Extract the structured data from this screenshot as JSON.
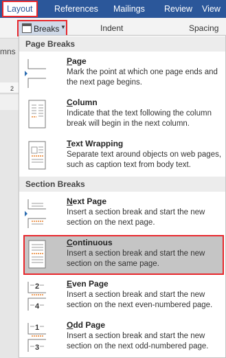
{
  "tabs": [
    {
      "label": "Layout",
      "active": true
    },
    {
      "label": "References",
      "active": false
    },
    {
      "label": "Mailings",
      "active": false
    },
    {
      "label": "Review",
      "active": false
    },
    {
      "label": "View",
      "active": false
    }
  ],
  "ribbon": {
    "breaks_label": "Breaks",
    "indent_label": "Indent",
    "spacing_label": "Spacing",
    "columns_fragment": "mns",
    "ruler_number": "2"
  },
  "menu": {
    "page_breaks_header": "Page Breaks",
    "section_breaks_header": "Section Breaks",
    "items": [
      {
        "title_u": "P",
        "title_rest": "age",
        "desc": "Mark the point at which one page ends and the next page begins."
      },
      {
        "title_u": "C",
        "title_rest": "olumn",
        "desc": "Indicate that the text following the column break will begin in the next column."
      },
      {
        "title_u": "T",
        "title_rest": "ext Wrapping",
        "desc": "Separate text around objects on web pages, such as caption text from body text."
      },
      {
        "title_u": "N",
        "title_rest": "ext Page",
        "desc": "Insert a section break and start the new section on the next page."
      },
      {
        "title_u": "C",
        "title_rest": "ontinuous",
        "desc": "Insert a section break and start the new section on the same page."
      },
      {
        "title_u": "E",
        "title_rest": "ven Page",
        "desc": "Insert a section break and start the new section on the next even-numbered page."
      },
      {
        "title_u": "O",
        "title_rest": "dd Page",
        "desc": "Insert a section break and start the new section on the next odd-numbered page."
      }
    ]
  },
  "icon_numbers": {
    "even_top": "2",
    "even_bottom": "4",
    "odd_top": "1",
    "odd_bottom": "3"
  },
  "colors": {
    "ribbon_blue": "#2b579a",
    "highlight_red": "#e8262b",
    "selected_gray": "#c5c5c5",
    "icon_orange": "#e8812a"
  }
}
